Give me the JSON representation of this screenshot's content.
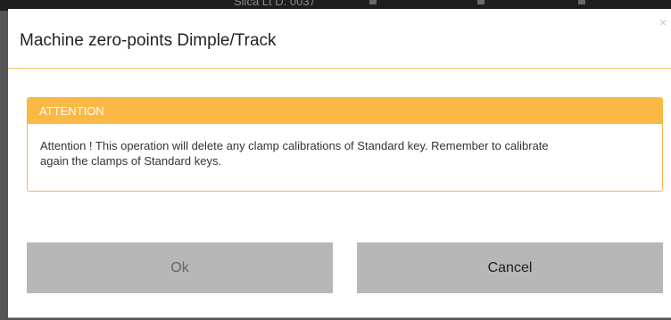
{
  "background": {
    "partial_text": "Silca Lt D. 0037"
  },
  "dialog": {
    "title": "Machine zero-points Dimple/Track",
    "close_label": "×",
    "alert": {
      "heading": "ATTENTION",
      "message": "Attention ! This operation will delete any clamp calibrations of Standard key. Remember to calibrate again the clamps of Standard keys."
    },
    "buttons": {
      "ok_label": "Ok",
      "cancel_label": "Cancel"
    }
  },
  "colors": {
    "alert_heading_bg": "#fbb845",
    "alert_border": "#f8b548",
    "header_divider": "#f3c368",
    "button_bg": "#b7b7b7",
    "backdrop": "#555555"
  }
}
